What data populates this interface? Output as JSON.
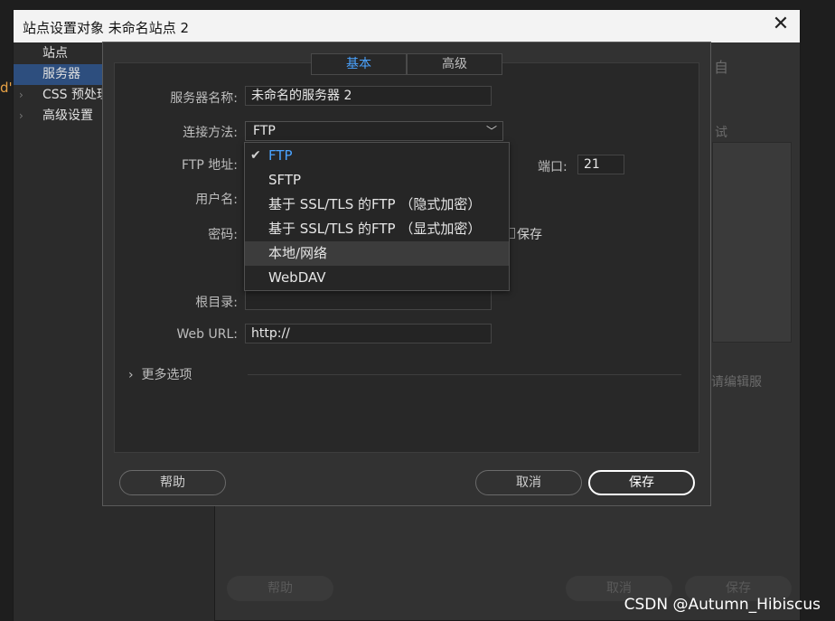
{
  "outer": {
    "title": "站点设置对象 未命名站点 2",
    "sidebar": [
      {
        "label": "站点"
      },
      {
        "label": "服务器"
      },
      {
        "label": "CSS 预处理"
      },
      {
        "label": "高级设置"
      }
    ],
    "partial_orange": "d'",
    "bg_fragments": [
      "自",
      "试",
      "请编辑服"
    ],
    "bg_help": "帮助",
    "bg_cancel": "取消",
    "bg_save": "保存"
  },
  "dialog": {
    "tabs": [
      "基本",
      "高级"
    ],
    "active_tab": 0,
    "fields": {
      "server_name_label": "服务器名称:",
      "server_name_value": "未命名的服务器 2",
      "connect_label": "连接方法:",
      "connect_value": "FTP",
      "ftp_addr_label": "FTP 地址:",
      "port_label": "端口:",
      "port_value": "21",
      "username_label": "用户名:",
      "password_label": "密码:",
      "save_pw_label": "保存",
      "root_label": "根目录:",
      "weburl_label": "Web URL:",
      "weburl_value": "http://"
    },
    "more_options": "更多选项",
    "buttons": {
      "help": "帮助",
      "cancel": "取消",
      "save": "保存"
    }
  },
  "dropdown": {
    "items": [
      "FTP",
      "SFTP",
      "基于 SSL/TLS 的FTP （隐式加密）",
      "基于 SSL/TLS 的FTP （显式加密）",
      "本地/网络",
      "WebDAV"
    ],
    "selected_index": 0,
    "hover_index": 4
  },
  "watermark": "CSDN @Autumn_Hibiscus",
  "colors": {
    "accent": "#4aa3ff",
    "selection": "#2d4e7e",
    "orange": "#e8a245"
  }
}
